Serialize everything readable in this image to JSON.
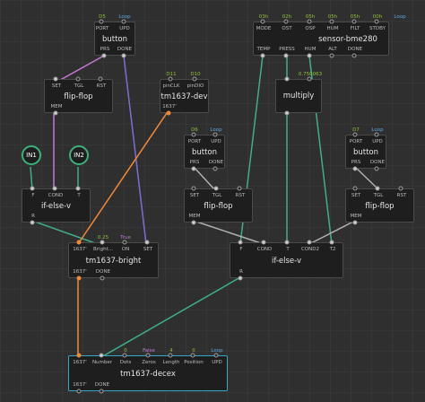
{
  "nodes": {
    "button_top": {
      "title": "button",
      "inputs": [
        {
          "label": "PORT",
          "value": "D5",
          "color": "green"
        },
        {
          "label": "UPD",
          "value": "Loop",
          "color": "blue"
        }
      ],
      "outputs": [
        "PRS",
        "DONE"
      ]
    },
    "flipflop_left": {
      "title": "flip-flop",
      "inputs": [
        "SET",
        "TGL",
        "RST"
      ],
      "outputs": [
        "MEM"
      ]
    },
    "tm1637dev": {
      "title": "tm1637-dev",
      "inputs": [
        {
          "label": "pinCLK",
          "value": "D11"
        },
        {
          "label": "pinDIO",
          "value": "D10"
        }
      ],
      "outputs": [
        "1637'"
      ]
    },
    "sensor": {
      "title": "sensor-bme280",
      "inputs": [
        {
          "label": "MODE",
          "value": "03h"
        },
        {
          "label": "OST",
          "value": "02h"
        },
        {
          "label": "OSP",
          "value": "05h"
        },
        {
          "label": "HUM",
          "value": "05h"
        },
        {
          "label": "FILT",
          "value": "05h"
        },
        {
          "label": "STDBY",
          "value": "00h"
        },
        {
          "label": "UPD",
          "value": "Loop"
        }
      ],
      "outputs": [
        "TEMP",
        "PRESS",
        "HUM",
        "ALT",
        "DONE"
      ]
    },
    "multiply": {
      "title": "multiply",
      "inputs": [
        {
          "label": "",
          "value": "0.750063"
        }
      ]
    },
    "button_right": {
      "title": "button",
      "inputs": [
        {
          "label": "PORT",
          "value": "D7"
        },
        {
          "label": "UPD",
          "value": "Loop"
        }
      ],
      "outputs": [
        "PRS",
        "DONE"
      ]
    },
    "button_mid": {
      "title": "button",
      "inputs": [
        {
          "label": "PORT",
          "value": "D6"
        },
        {
          "label": "UPD",
          "value": "Loop"
        }
      ],
      "outputs": [
        "PRS",
        "DONE"
      ]
    },
    "flipflop_mid": {
      "title": "flip-flop",
      "inputs": [
        "SET",
        "TGL",
        "RST"
      ],
      "outputs": [
        "MEM"
      ]
    },
    "flipflop_right": {
      "title": "flip-flop",
      "inputs": [
        "SET",
        "TGL",
        "RST"
      ],
      "outputs": [
        "MEM"
      ]
    },
    "watch_in1": {
      "title": "IN1"
    },
    "watch_in2": {
      "title": "IN2"
    },
    "ifelse_left": {
      "title": "if-else-v",
      "inputs": [
        "F",
        "COND",
        "T"
      ],
      "outputs": [
        "R"
      ]
    },
    "tm1637bright": {
      "title": "tm1637-bright",
      "inputs": [
        {
          "label": "1637'",
          "value": ""
        },
        {
          "label": "Bright...",
          "value": "0.25"
        },
        {
          "label": "ON",
          "value": "True"
        },
        {
          "label": "SET",
          "value": ""
        }
      ],
      "outputs": [
        "1637'",
        "DONE"
      ]
    },
    "ifelse_right": {
      "title": "if-else-v",
      "inputs": [
        "F",
        "COND",
        "T",
        "COND2",
        "T2"
      ],
      "outputs": [
        "R"
      ]
    },
    "tm1637decex": {
      "title": "tm1637-decex",
      "inputs": [
        {
          "label": "1637'",
          "value": ""
        },
        {
          "label": "Number",
          "value": ""
        },
        {
          "label": "Dots",
          "value": "0"
        },
        {
          "label": "Zeros",
          "value": "False"
        },
        {
          "label": "Length",
          "value": "4"
        },
        {
          "label": "Position",
          "value": "0"
        },
        {
          "label": "UPD",
          "value": "Loop"
        }
      ],
      "outputs": [
        "1637'",
        "DONE"
      ]
    }
  },
  "colors": {
    "wire_gray": "#b0b0b0",
    "wire_green": "#3eae8c",
    "wire_purple": "#c679d6",
    "wire_orange": "#f0883a",
    "wire_blue": "#7b6fd6",
    "selected_border": "#35a7c9"
  }
}
